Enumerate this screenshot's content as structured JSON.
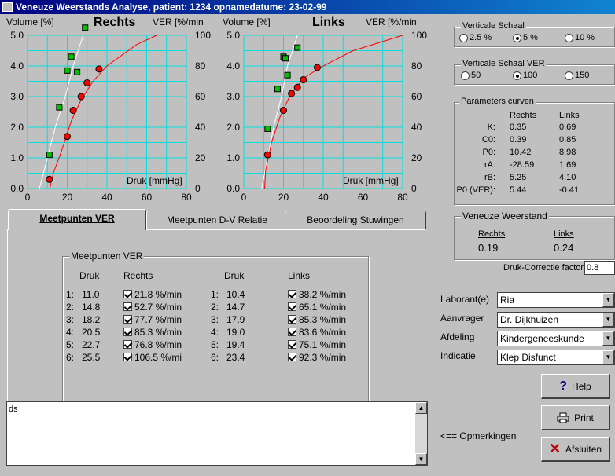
{
  "window": {
    "title": "Veneuze Weerstands Analyse,  patient: 1234   opnamedatume: 23-02-99"
  },
  "chart_data": [
    {
      "type": "scatter",
      "title": "Rechts",
      "xlabel": "Druk [mmHg]",
      "ylabel": "Volume [%]",
      "y2label": "VER [%/min",
      "xlim": [
        0,
        80
      ],
      "ylim": [
        0,
        5
      ],
      "y2lim": [
        0,
        100
      ],
      "xticks": [
        "0",
        "20",
        "40",
        "60",
        "80"
      ],
      "yticks": [
        "0.0",
        "1.0",
        "2.0",
        "3.0",
        "4.0",
        "5.0"
      ],
      "y2ticks": [
        "0",
        "20",
        "40",
        "60",
        "80",
        "100"
      ],
      "grid": true,
      "series": [
        {
          "kind": "volume-points",
          "color": "#00c000",
          "points": [
            [
              11,
              1.1
            ],
            [
              16,
              2.65
            ],
            [
              20,
              3.85
            ],
            [
              22,
              4.3
            ],
            [
              25,
              3.8
            ],
            [
              29,
              5.25
            ]
          ]
        },
        {
          "kind": "ver-points",
          "color": "#ff0000",
          "points": [
            [
              11,
              0.3
            ],
            [
              20,
              1.7
            ],
            [
              23,
              2.55
            ],
            [
              27,
              3.0
            ],
            [
              30,
              3.45
            ],
            [
              36,
              3.9
            ]
          ]
        },
        {
          "kind": "volume-curve",
          "color": "#ffffff",
          "points": [
            [
              6,
              0
            ],
            [
              10,
              1.0
            ],
            [
              14,
              2.0
            ],
            [
              19,
              3.0
            ],
            [
              23,
              4.0
            ],
            [
              28,
              5.0
            ]
          ]
        },
        {
          "kind": "ver-curve",
          "color": "#ff0000",
          "points": [
            [
              11.2,
              0
            ],
            [
              13,
              0.5
            ],
            [
              17,
              1.2
            ],
            [
              22,
              2.2
            ],
            [
              27,
              2.9
            ],
            [
              33,
              3.5
            ],
            [
              40,
              4.0
            ],
            [
              55,
              4.7
            ],
            [
              65,
              5.0
            ]
          ]
        }
      ]
    },
    {
      "type": "scatter",
      "title": "Links",
      "xlabel": "Druk [mmHg]",
      "ylabel": "Volume [%]",
      "y2label": "VER [%/min",
      "xlim": [
        0,
        80
      ],
      "ylim": [
        0,
        5
      ],
      "y2lim": [
        0,
        100
      ],
      "xticks": [
        "0",
        "20",
        "40",
        "60",
        "80"
      ],
      "yticks": [
        "0.0",
        "1.0",
        "2.0",
        "3.0",
        "4.0",
        "5.0"
      ],
      "y2ticks": [
        "0",
        "20",
        "40",
        "60",
        "80",
        "100"
      ],
      "grid": true,
      "series": [
        {
          "kind": "volume-points",
          "color": "#00c000",
          "points": [
            [
              12,
              1.95
            ],
            [
              17,
              3.25
            ],
            [
              20,
              4.3
            ],
            [
              21,
              4.25
            ],
            [
              22,
              3.7
            ],
            [
              27,
              4.6
            ]
          ]
        },
        {
          "kind": "ver-points",
          "color": "#ff0000",
          "points": [
            [
              12,
              1.1
            ],
            [
              20,
              2.55
            ],
            [
              24,
              3.1
            ],
            [
              27,
              3.3
            ],
            [
              30,
              3.55
            ],
            [
              37,
              3.95
            ]
          ]
        },
        {
          "kind": "volume-curve",
          "color": "#ffffff",
          "points": [
            [
              9,
              0
            ],
            [
              12,
              1.0
            ],
            [
              15,
              2.0
            ],
            [
              19,
              3.0
            ],
            [
              22,
              4.0
            ],
            [
              27,
              5.0
            ]
          ]
        },
        {
          "kind": "ver-curve",
          "color": "#ff0000",
          "points": [
            [
              10.5,
              0
            ],
            [
              11,
              0.6
            ],
            [
              14,
              1.5
            ],
            [
              18,
              2.3
            ],
            [
              23,
              3.0
            ],
            [
              30,
              3.6
            ],
            [
              40,
              4.0
            ],
            [
              55,
              4.5
            ],
            [
              80,
              5.0
            ]
          ]
        }
      ]
    }
  ],
  "vertical_scale": {
    "title": "Verticale Schaal",
    "options": [
      "2.5 %",
      "5 %",
      "10 %"
    ],
    "selected": 1
  },
  "vertical_scale_ver": {
    "title": "Verticale Schaal  VER",
    "options": [
      "50",
      "100",
      "150"
    ],
    "selected": 1
  },
  "params": {
    "title": "Parameters curven",
    "col_rechts": "Rechts",
    "col_links": "Links",
    "rows": [
      {
        "name": "K:",
        "rechts": "0.35",
        "links": "0.69"
      },
      {
        "name": "C0:",
        "rechts": "0.39",
        "links": "0.85"
      },
      {
        "name": "P0:",
        "rechts": "10.42",
        "links": "8.98"
      },
      {
        "name": "rA:",
        "rechts": "-28.59",
        "links": "1.69"
      },
      {
        "name": "rB:",
        "rechts": "5.25",
        "links": "4.10"
      },
      {
        "name": "P0 (VER):",
        "rechts": "5.44",
        "links": "-0.41"
      }
    ]
  },
  "resistance": {
    "title": "Veneuze Weerstand",
    "col_rechts": "Rechts",
    "col_links": "Links",
    "rechts": "0.19",
    "links": "0.24"
  },
  "correction": {
    "label": "Druk-Correctie factor",
    "value": "0.8"
  },
  "tabs": [
    "Meetpunten VER",
    "Meetpunten D-V Relatie",
    "Beoordeling Stuwingen"
  ],
  "meetpunten": {
    "title": "Meetpunten VER",
    "h_druk": "Druk",
    "h_rechts": "Rechts",
    "h_links": "Links",
    "rows": [
      {
        "n": "1:",
        "druk_r": "11.0",
        "rechts": "21.8 %/min",
        "druk_l": "10.4",
        "links": "38.2 %/min"
      },
      {
        "n": "2:",
        "druk_r": "14.8",
        "rechts": "52.7 %/min",
        "druk_l": "14.7",
        "links": "65.1 %/min"
      },
      {
        "n": "3:",
        "druk_r": "18.2",
        "rechts": "77.7 %/min",
        "druk_l": "17.9",
        "links": "85.3 %/min"
      },
      {
        "n": "4:",
        "druk_r": "20.5",
        "rechts": "85.3 %/min",
        "druk_l": "19.0",
        "links": "83.6 %/min"
      },
      {
        "n": "5:",
        "druk_r": "22.7",
        "rechts": "76.8 %/min",
        "druk_l": "19.4",
        "links": "75.1 %/min"
      },
      {
        "n": "6:",
        "druk_r": "25.5",
        "rechts": "106.5 %/mi",
        "druk_l": "23.4",
        "links": "92.3 %/min"
      }
    ]
  },
  "remarks": {
    "text": "ds",
    "label": "<== Opmerkingen"
  },
  "form": {
    "laborant_label": "Laborant(e)",
    "laborant": "Ria",
    "aanvrager_label": "Aanvrager",
    "aanvrager": "Dr. Dijkhuizen",
    "afdeling_label": "Afdeling",
    "afdeling": "Kindergeneeskunde",
    "indicatie_label": "Indicatie",
    "indicatie": "Klep Disfunct"
  },
  "buttons": {
    "help": "Help",
    "print": "Print",
    "close": "Afsluiten"
  }
}
